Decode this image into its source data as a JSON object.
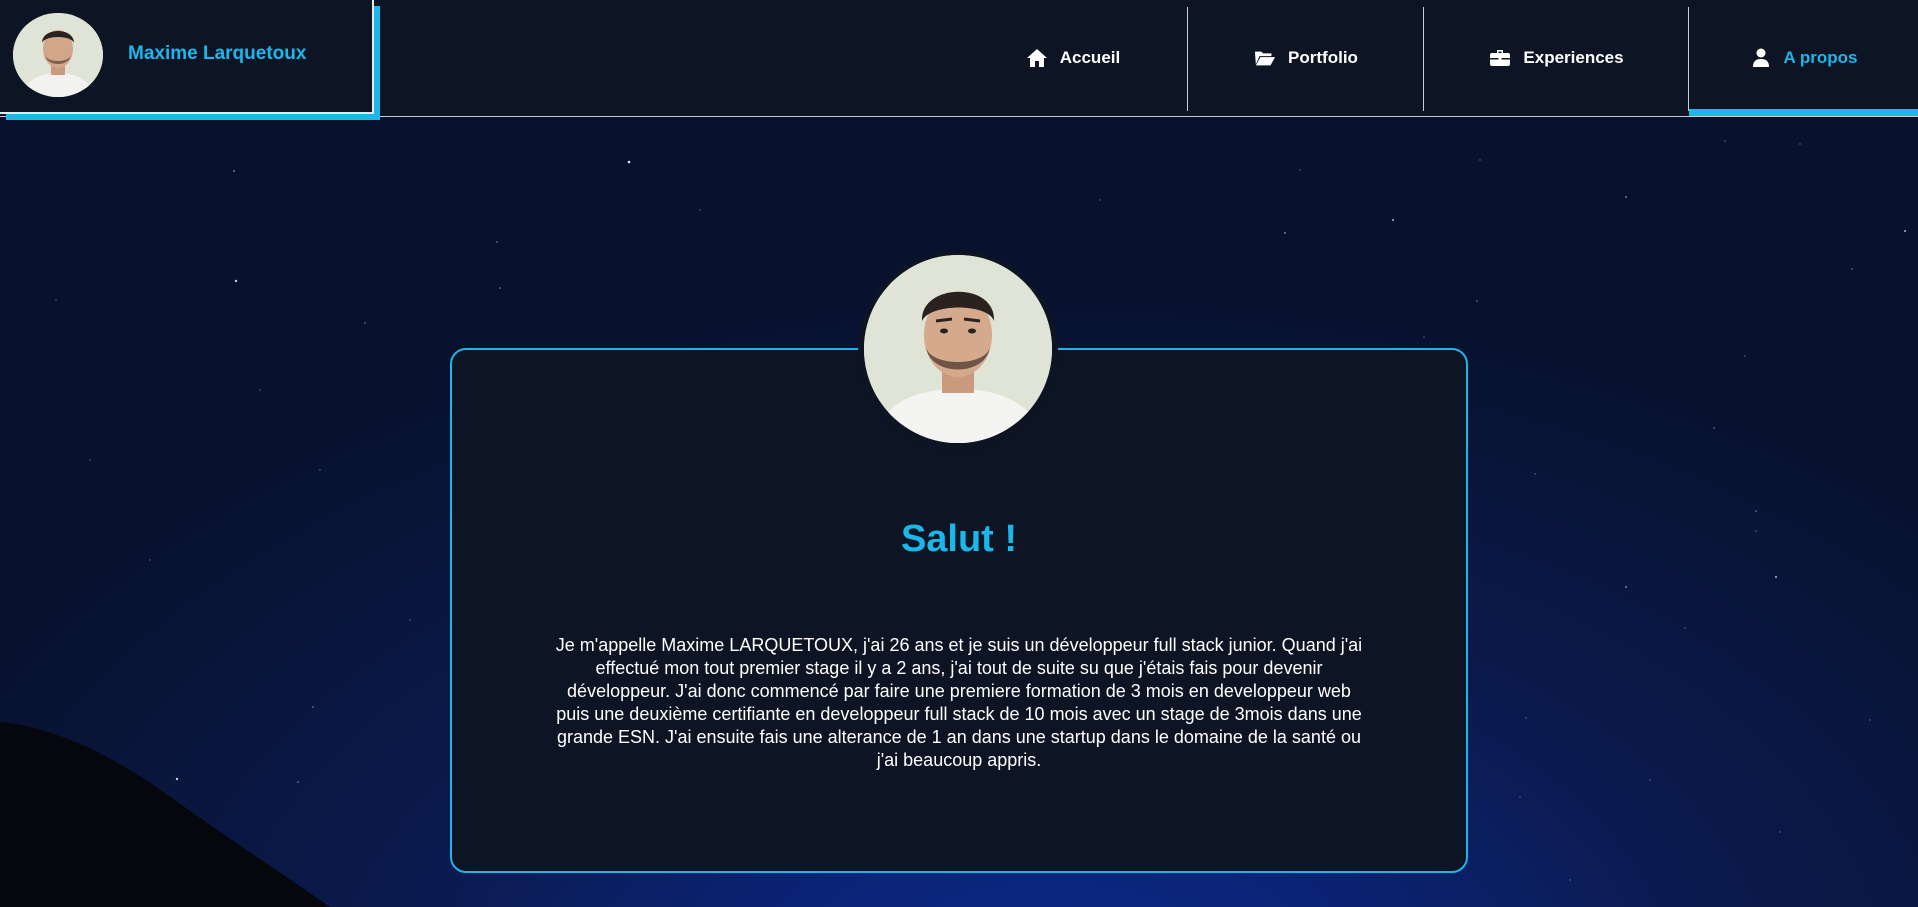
{
  "header": {
    "brand_name": "Maxime Larquetoux",
    "nav": [
      {
        "label": "Accueil",
        "icon": "home-icon",
        "active": false
      },
      {
        "label": "Portfolio",
        "icon": "folder-open-icon",
        "active": false
      },
      {
        "label": "Experiences",
        "icon": "briefcase-icon",
        "active": false
      },
      {
        "label": "A propos",
        "icon": "user-icon",
        "active": true
      }
    ]
  },
  "about": {
    "title": "Salut !",
    "text": "Je m'appelle Maxime LARQUETOUX, j'ai 26 ans et je suis un développeur full stack junior. Quand j'ai effectué mon tout premier stage il y a 2 ans, j'ai tout de suite su que j'étais fais pour devenir développeur. J'ai donc commencé par faire une premiere formation de 3 mois en developpeur web puis une deuxième certifiante en developpeur full stack de 10 mois avec un stage de 3mois dans une grande ESN. J'ai ensuite fais une alterance de 1 an dans une startup dans le domaine de la santé ou j'ai beaucoup appris."
  },
  "colors": {
    "accent": "#1ab7ea",
    "panel": "#0d1424",
    "text": "#ffffff"
  }
}
